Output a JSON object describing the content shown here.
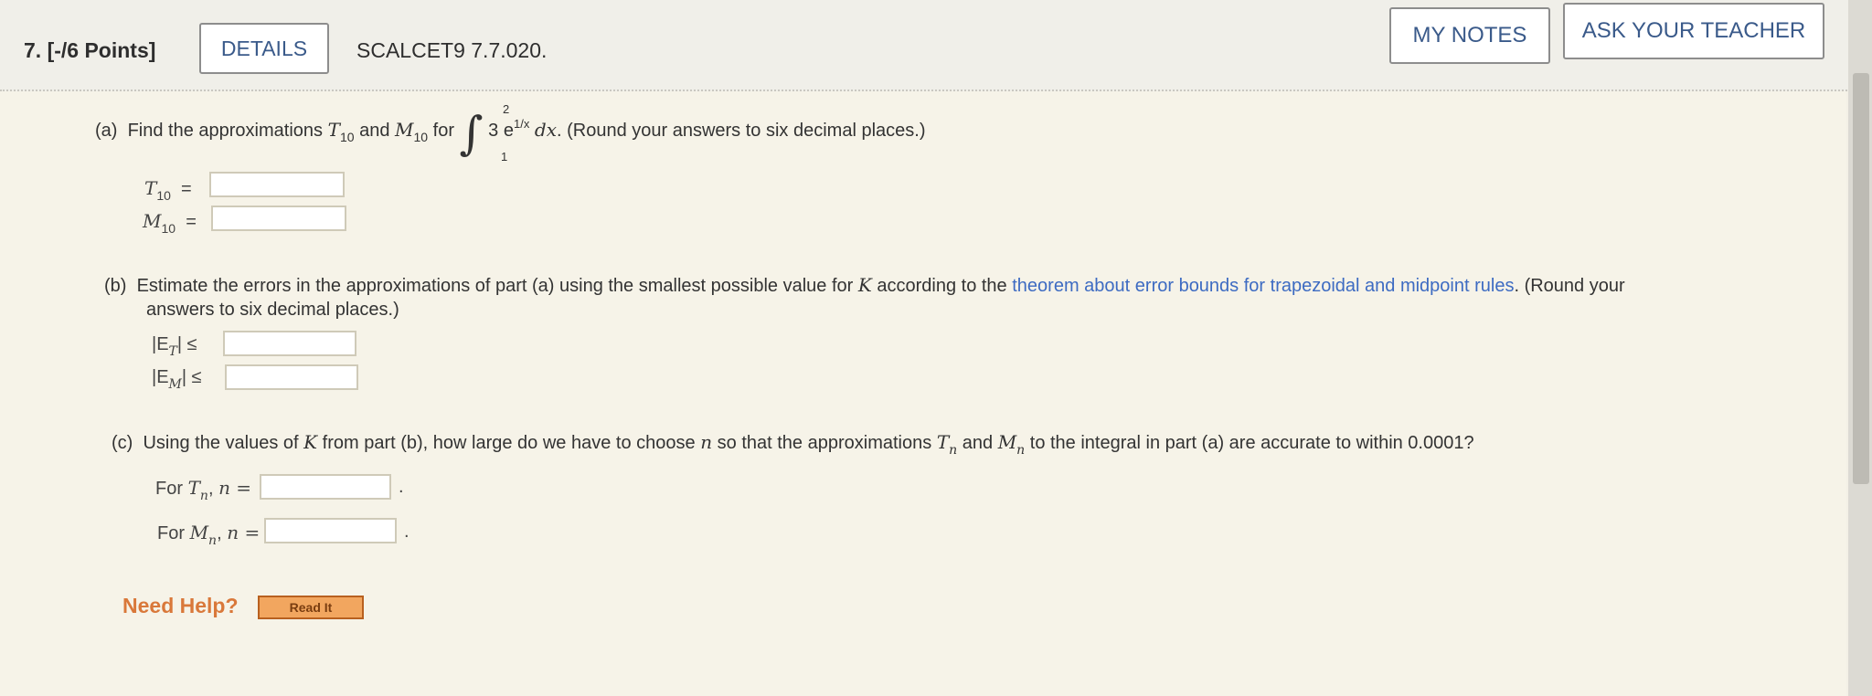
{
  "header": {
    "question_label": "7. [-/6 Points]",
    "details_label": "DETAILS",
    "problem_id": "SCALCET9 7.7.020.",
    "my_notes_label": "MY NOTES",
    "ask_teacher_label": "ASK YOUR TEACHER"
  },
  "part_a": {
    "prefix": "(a)",
    "text_1": "Find the approximations",
    "T": "T",
    "sub_10": "10",
    "and": "and",
    "M": "M",
    "for": "for",
    "integrand": "3",
    "exp_base": "e",
    "exponent": "1/x",
    "dx": "dx",
    "round_note": ". (Round your answers to six decimal places.)",
    "lower_limit": "1",
    "upper_limit": "2",
    "eq": "=",
    "T10_value": "",
    "M10_value": ""
  },
  "part_b": {
    "prefix": "(b)",
    "text_1": "Estimate the errors in the approximations of part (a) using the smallest possible value for",
    "K": "K",
    "text_2": "according to the",
    "link_text": "theorem about error bounds for trapezoidal and midpoint rules",
    "text_3": ". (Round your",
    "text_4": "answers to six decimal places.)",
    "ET_label": "|E",
    "ET_sub": "T",
    "EM_label": "|E",
    "EM_sub": "M",
    "bar_leq": "|  ≤",
    "ET_value": "",
    "EM_value": ""
  },
  "part_c": {
    "prefix": "(c)",
    "text_1": "Using the values of",
    "K": "K",
    "text_2": "from part (b), how large do we have to choose",
    "n": "n",
    "text_3": "so that the approximations",
    "T": "T",
    "and": "and",
    "M": "M",
    "text_4": "to the integral in part (a) are accurate to within 0.0001?",
    "for_label": "For",
    "n_eq": "n =",
    "Tn_value": "",
    "Mn_value": ""
  },
  "help": {
    "need_help": "Need Help?",
    "read_it": "Read It"
  }
}
